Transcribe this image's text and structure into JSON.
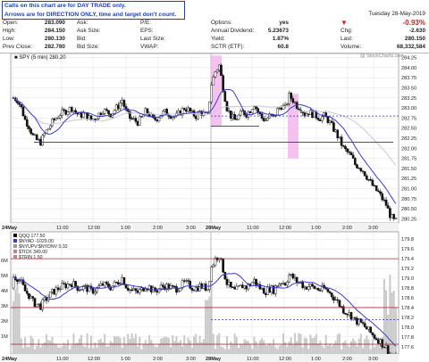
{
  "notice": {
    "line1": "Calls on this chart are for DAY TRADE only.",
    "line2": "Arrows are for DIRECTION ONLY, time and target don't count."
  },
  "quote": {
    "open_label": "Open:",
    "open": "283.090",
    "high_label": "High:",
    "high": "284.150",
    "low_label": "Low:",
    "low": "280.130",
    "prev_close_label": "Prev Close:",
    "prev_close": "282.780",
    "ask_label": "Ask:",
    "ask": "",
    "bid_label": "Bid:",
    "bid": "",
    "bid_size_label": "Bid Size:",
    "bid_size": "",
    "pe_label": "P/E:",
    "pe": "",
    "eps_label": "EPS:",
    "eps": "",
    "last_size_label": "Last Size:",
    "last_size": "",
    "vwap_label": "VWAP:",
    "vwap": "",
    "options_label": "Options:",
    "options": "yes",
    "annual_dividend_label": "Annual Dividend:",
    "annual_dividend": "5.23673",
    "yield_label": "Yield:",
    "yield": "1.87%",
    "sctr_label": "SCTR (ETF):",
    "sctr": "60.8",
    "date": "Tuesday  28-May-2019",
    "change_pct": "-0.93%",
    "chg_label": "Chg:",
    "chg": "-2.630",
    "last_label": "Last:",
    "last": "280.150",
    "volume_label": "Volume:",
    "volume": "68,332,584",
    "down_arrow_color": "#d42020"
  },
  "watermark": "@ StockCharts.com",
  "chart_data": [
    {
      "type": "candlestick",
      "title": "SPY (5 min) 280.20",
      "symbol": "SPY",
      "interval": "5 min",
      "last_value": "280.20",
      "ylim": [
        280.15,
        284.35
      ],
      "yticks": [
        "284.25",
        "284.00",
        "283.75",
        "283.50",
        "283.25",
        "283.00",
        "282.75",
        "282.50",
        "282.25",
        "282.00",
        "281.75",
        "281.50",
        "281.25",
        "281.00",
        "280.75",
        "280.50",
        "280.25"
      ],
      "xticks": [
        "24May",
        "11:00",
        "12:00",
        "1:00",
        "2:00",
        "3:00",
        "28May",
        "11:00",
        "12:00",
        "1:00",
        "2:00",
        "3:00"
      ],
      "close_path": [
        283.25,
        283.2,
        283.0,
        282.7,
        282.55,
        282.3,
        282.2,
        282.15,
        282.35,
        282.5,
        282.65,
        282.75,
        282.85,
        282.9,
        282.95,
        283.0,
        282.9,
        282.8,
        282.85,
        282.8,
        282.7,
        282.75,
        282.85,
        282.95,
        282.9,
        282.85,
        282.95,
        283.05,
        283.2,
        282.9,
        282.75,
        282.7,
        282.65,
        282.75,
        282.9,
        282.85,
        282.7,
        282.75,
        282.85,
        282.9,
        282.85,
        282.8,
        282.8,
        282.9,
        283.0,
        282.95,
        282.85,
        282.8,
        282.9,
        282.85,
        282.8,
        283.6,
        283.9,
        284.05,
        283.5,
        283.0,
        282.8,
        282.7,
        282.8,
        282.9,
        282.85,
        282.95,
        283.1,
        282.9,
        282.75,
        282.7,
        282.8,
        282.75,
        282.95,
        283.05,
        283.0,
        283.3,
        283.2,
        283.05,
        283.0,
        282.85,
        282.9,
        282.85,
        282.8,
        282.75,
        282.8,
        282.7,
        282.55,
        282.4,
        282.2,
        282.0,
        281.9,
        281.8,
        281.6,
        281.55,
        281.45,
        281.3,
        281.15,
        281.0,
        280.9,
        280.75,
        280.6,
        280.35,
        280.2
      ],
      "lines": [
        {
          "name": "horizontal support",
          "value": 282.15,
          "color": "#3030a0"
        },
        {
          "name": "dashed level",
          "value": 282.8,
          "color": "#3030c0",
          "dashed": true
        },
        {
          "name": "short range line",
          "value": 282.55,
          "color": "#3030a0"
        }
      ],
      "highlights": [
        "28May open spike",
        "12:00 pullback"
      ]
    },
    {
      "type": "candlestick",
      "symbol": "QQQ",
      "title_lines": [
        "QQQ 177.50",
        "$NYAD -1029.00",
        "$NYUPV:$NYDNV 0.32",
        "$TICK 349.00",
        "$TRIN 1.50"
      ],
      "ylim": [
        177.45,
        179.95
      ],
      "yticks": [
        "179.8",
        "179.6",
        "179.4",
        "179.2",
        "179.0",
        "178.8",
        "178.6",
        "178.4",
        "178.2",
        "178.0",
        "177.8",
        "177.6"
      ],
      "volume_ticks": [
        "6M",
        "5M",
        "4M",
        "3M",
        "2M",
        "1M"
      ],
      "xticks": [
        "24May",
        "11:00",
        "12:00",
        "1:00",
        "2:00",
        "3:00",
        "28May",
        "11:00",
        "12:00",
        "1:00",
        "2:00",
        "3:00"
      ],
      "lines": [
        {
          "name": "upper level",
          "value": 179.4,
          "color": "#a83040"
        },
        {
          "name": "middle level",
          "value": 178.4,
          "color": "#a83040"
        },
        {
          "name": "lower level",
          "value": 177.65,
          "color": "#a83040"
        },
        {
          "name": "dashed level",
          "value": 178.15,
          "color": "#3030c0",
          "dashed": true
        }
      ]
    }
  ],
  "colors": {
    "up_candle": "#ffffff",
    "down_candle": "#111111",
    "ma": "#3a3ad0",
    "ma2": "#c8c8d8",
    "highlight": "#f3b6ec",
    "grid": "#e0e0e0"
  }
}
